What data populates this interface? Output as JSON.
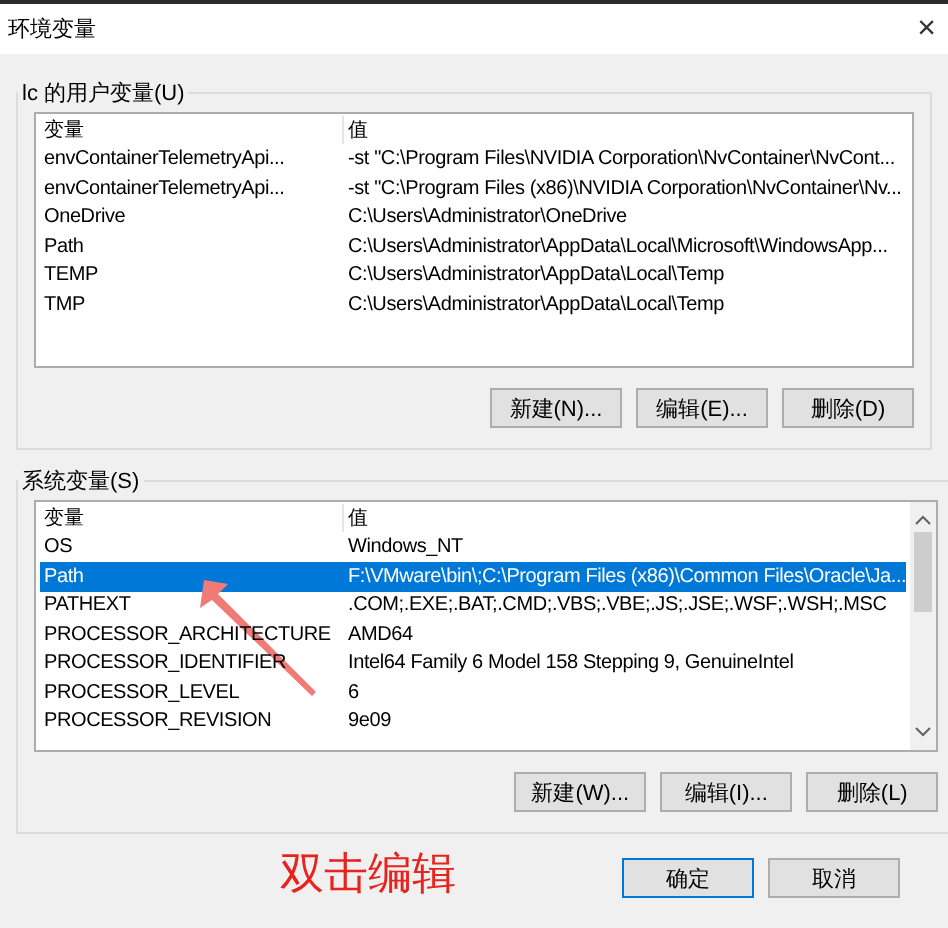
{
  "window": {
    "title": "环境变量",
    "close": "×"
  },
  "user_variables": {
    "legend": "lc 的用户变量(U)",
    "columns": [
      "变量",
      "值"
    ],
    "rows": [
      {
        "name": "envContainerTelemetryApi...",
        "value": "-st \"C:\\Program Files\\NVIDIA Corporation\\NvContainer\\NvCont...",
        "selected": false
      },
      {
        "name": "envContainerTelemetryApi...",
        "value": "-st \"C:\\Program Files (x86)\\NVIDIA Corporation\\NvContainer\\Nv...",
        "selected": false
      },
      {
        "name": "OneDrive",
        "value": "C:\\Users\\Administrator\\OneDrive",
        "selected": false
      },
      {
        "name": "Path",
        "value": "C:\\Users\\Administrator\\AppData\\Local\\Microsoft\\WindowsApp...",
        "selected": false
      },
      {
        "name": "TEMP",
        "value": "C:\\Users\\Administrator\\AppData\\Local\\Temp",
        "selected": false
      },
      {
        "name": "TMP",
        "value": "C:\\Users\\Administrator\\AppData\\Local\\Temp",
        "selected": false
      }
    ],
    "buttons": [
      "新建(N)...",
      "编辑(E)...",
      "删除(D)"
    ]
  },
  "system_variables": {
    "legend": "系统变量(S)",
    "columns": [
      "变量",
      "值"
    ],
    "rows": [
      {
        "name": "OS",
        "value": "Windows_NT",
        "selected": false
      },
      {
        "name": "Path",
        "value": "F:\\VMware\\bin\\;C:\\Program Files (x86)\\Common Files\\Oracle\\Ja...",
        "selected": true
      },
      {
        "name": "PATHEXT",
        "value": ".COM;.EXE;.BAT;.CMD;.VBS;.VBE;.JS;.JSE;.WSF;.WSH;.MSC",
        "selected": false
      },
      {
        "name": "PROCESSOR_ARCHITECTURE",
        "value": "AMD64",
        "selected": false
      },
      {
        "name": "PROCESSOR_IDENTIFIER",
        "value": "Intel64 Family 6 Model 158 Stepping 9, GenuineIntel",
        "selected": false
      },
      {
        "name": "PROCESSOR_LEVEL",
        "value": "6",
        "selected": false
      },
      {
        "name": "PROCESSOR_REVISION",
        "value": "9e09",
        "selected": false
      }
    ],
    "buttons": [
      "新建(W)...",
      "编辑(I)...",
      "删除(L)"
    ]
  },
  "annotation": {
    "text": "双击编辑"
  },
  "dialog_buttons": [
    {
      "label": "确定",
      "kind": "default"
    },
    {
      "label": "取消",
      "kind": "normal"
    }
  ]
}
